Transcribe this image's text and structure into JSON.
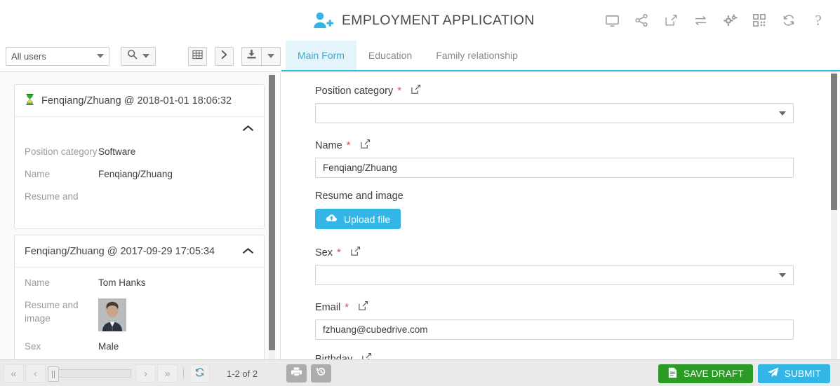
{
  "header": {
    "title": "EMPLOYMENT APPLICATION",
    "app_icon": "user-add-icon",
    "icons": [
      {
        "name": "monitor-icon",
        "label": "Desktop"
      },
      {
        "name": "share-icon",
        "label": "Share"
      },
      {
        "name": "edit-icon",
        "label": "Edit"
      },
      {
        "name": "transfer-icon",
        "label": "Transfer"
      },
      {
        "name": "settings-gears-icon",
        "label": "Settings"
      },
      {
        "name": "qrcode-icon",
        "label": "QR Code"
      },
      {
        "name": "refresh-icon",
        "label": "Refresh"
      },
      {
        "name": "help-icon",
        "label": "?"
      }
    ]
  },
  "sidebar": {
    "toolbar": {
      "user_filter_value": "All users",
      "search_icon": "search-icon",
      "grid_icon": "table-grid-icon",
      "next_icon": "chevron-right-icon",
      "download_icon": "download-icon"
    },
    "cards": [
      {
        "status_icon": "hourglass-icon",
        "title": "Fenqiang/Zhuang @ 2018-01-01 18:06:32",
        "collapse_icon": "chevron-up-icon",
        "rows": [
          {
            "key": "Position category",
            "value": "Software",
            "type": "text"
          },
          {
            "key": "Name",
            "value": "Fenqiang/Zhuang",
            "type": "text"
          },
          {
            "key": "Resume and",
            "value": "",
            "type": "text"
          }
        ]
      },
      {
        "status_icon": "",
        "title": "Fenqiang/Zhuang @ 2017-09-29 17:05:34",
        "collapse_icon": "chevron-up-icon",
        "rows": [
          {
            "key": "Name",
            "value": "Tom Hanks",
            "type": "text"
          },
          {
            "key": "Resume and image",
            "value": "",
            "type": "image"
          },
          {
            "key": "Sex",
            "value": "Male",
            "type": "text"
          }
        ]
      }
    ]
  },
  "main": {
    "tabs": [
      {
        "label": "Main Form",
        "active": true
      },
      {
        "label": "Education",
        "active": false
      },
      {
        "label": "Family relationship",
        "active": false
      }
    ],
    "fields": [
      {
        "label": "Position category",
        "required": true,
        "edit_icon": "pencil-edit-icon",
        "type": "select",
        "value": ""
      },
      {
        "label": "Name",
        "required": true,
        "edit_icon": "pencil-edit-icon",
        "type": "input",
        "value": "Fenqiang/Zhuang"
      },
      {
        "label": "Resume and image",
        "required": false,
        "edit_icon": "",
        "type": "upload",
        "value": "",
        "button_label": "Upload file",
        "button_icon": "cloud-upload-icon"
      },
      {
        "label": "Sex",
        "required": true,
        "edit_icon": "pencil-edit-icon",
        "type": "select",
        "value": ""
      },
      {
        "label": "Email",
        "required": true,
        "edit_icon": "pencil-edit-icon",
        "type": "input",
        "value": "fzhuang@cubedrive.com"
      },
      {
        "label": "Birthday",
        "required": false,
        "edit_icon": "pencil-edit-icon",
        "type": "date",
        "value": "",
        "date_icon": "calendar-icon"
      }
    ]
  },
  "bottom": {
    "pagination": {
      "first_icon": "double-chevron-left-icon",
      "prev_icon": "chevron-left-icon",
      "next_icon": "chevron-right-icon",
      "last_icon": "double-chevron-right-icon",
      "refresh_icon": "refresh-icon",
      "count_label": "1-2 of 2"
    },
    "tools": [
      {
        "name": "print-button",
        "icon": "printer-icon"
      },
      {
        "name": "history-button",
        "icon": "history-undo-icon"
      }
    ],
    "actions": {
      "save_draft_label": "SAVE DRAFT",
      "save_draft_icon": "document-icon",
      "submit_label": "SUBMIT",
      "submit_icon": "paper-plane-icon"
    }
  },
  "colors": {
    "accent_blue": "#33b5e5",
    "save_green": "#2b9b26",
    "required_red": "#e04b4b",
    "tab_active_bg": "#e4f4fb"
  }
}
